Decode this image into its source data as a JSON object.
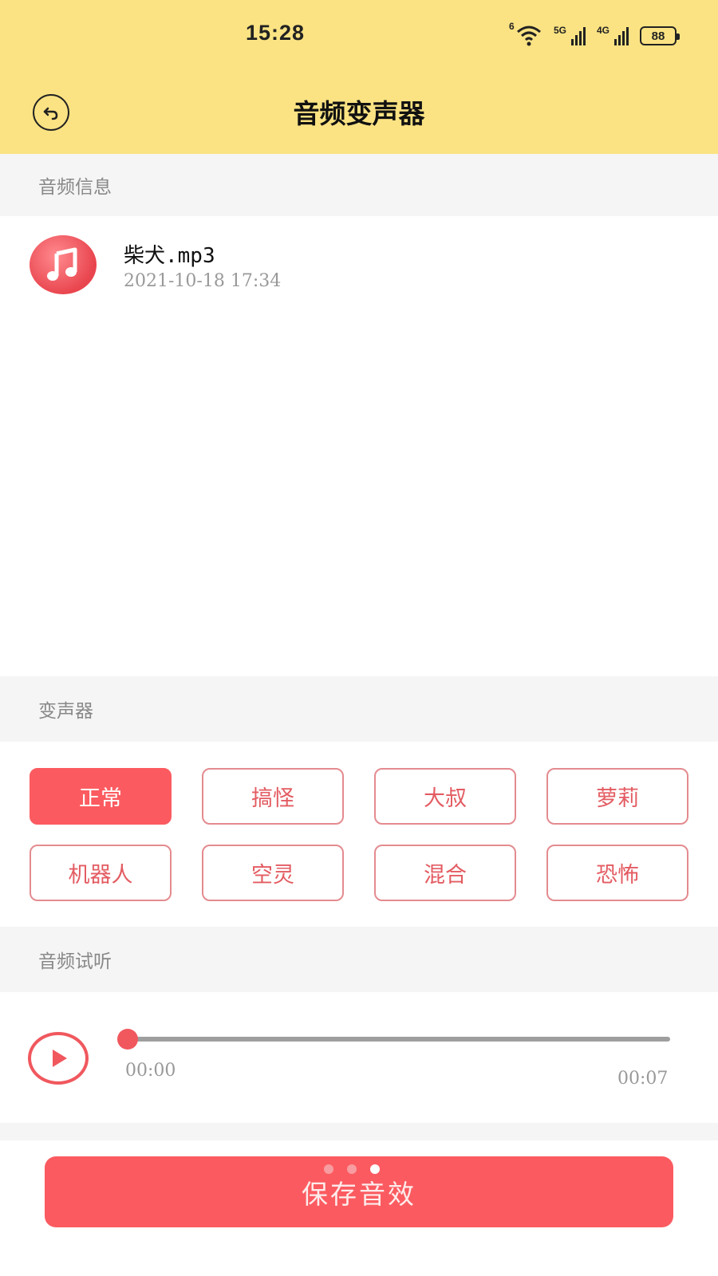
{
  "status_bar": {
    "time": "15:28",
    "wifi_label": "6",
    "signal_1_label": "5G",
    "signal_2_label": "4G",
    "battery": "88"
  },
  "header": {
    "title": "音频变声器",
    "back_icon": "back-arrow-circle-icon"
  },
  "audio_info": {
    "section_title": "音频信息",
    "file_name": "柴犬.mp3",
    "file_date": "2021-10-18  17:34",
    "file_icon": "music-note-icon"
  },
  "voice_changer": {
    "section_title": "变声器",
    "effects": [
      {
        "label": "正常",
        "selected": true
      },
      {
        "label": "搞怪",
        "selected": false
      },
      {
        "label": "大叔",
        "selected": false
      },
      {
        "label": "萝莉",
        "selected": false
      },
      {
        "label": "机器人",
        "selected": false
      },
      {
        "label": "空灵",
        "selected": false
      },
      {
        "label": "混合",
        "selected": false
      },
      {
        "label": "恐怖",
        "selected": false
      }
    ]
  },
  "preview": {
    "section_title": "音频试听",
    "current_time": "00:00",
    "total_time": "00:07",
    "progress": 0
  },
  "save": {
    "label": "保存音效"
  },
  "colors": {
    "header_bg": "#fbe383",
    "accent": "#fb5b60",
    "section_bg": "#f5f5f5"
  }
}
